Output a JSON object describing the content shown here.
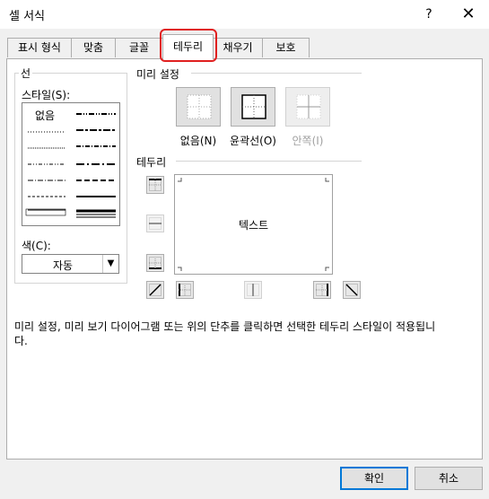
{
  "window": {
    "title": "셀 서식",
    "help": "?",
    "close": "✕"
  },
  "tabs": [
    "표시 형식",
    "맞춤",
    "글꼴",
    "테두리",
    "채우기",
    "보호"
  ],
  "line": {
    "group_label": "선",
    "style_label": "스타일(S):",
    "none_label": "없음",
    "color_label": "색(C):",
    "color_value": "자동"
  },
  "presets": {
    "group_label": "미리 설정",
    "items": [
      "없음(N)",
      "윤곽선(O)",
      "안쪽(I)"
    ]
  },
  "border": {
    "group_label": "테두리",
    "preview_text": "텍스트"
  },
  "description": "미리 설정, 미리 보기 다이어그램 또는 위의 단추를 클릭하면 선택한 테두리 스타일이 적용됩니다.",
  "buttons": {
    "ok": "확인",
    "cancel": "취소"
  },
  "colors": {
    "highlight": "#e02020",
    "default_button": "#0078d7"
  }
}
